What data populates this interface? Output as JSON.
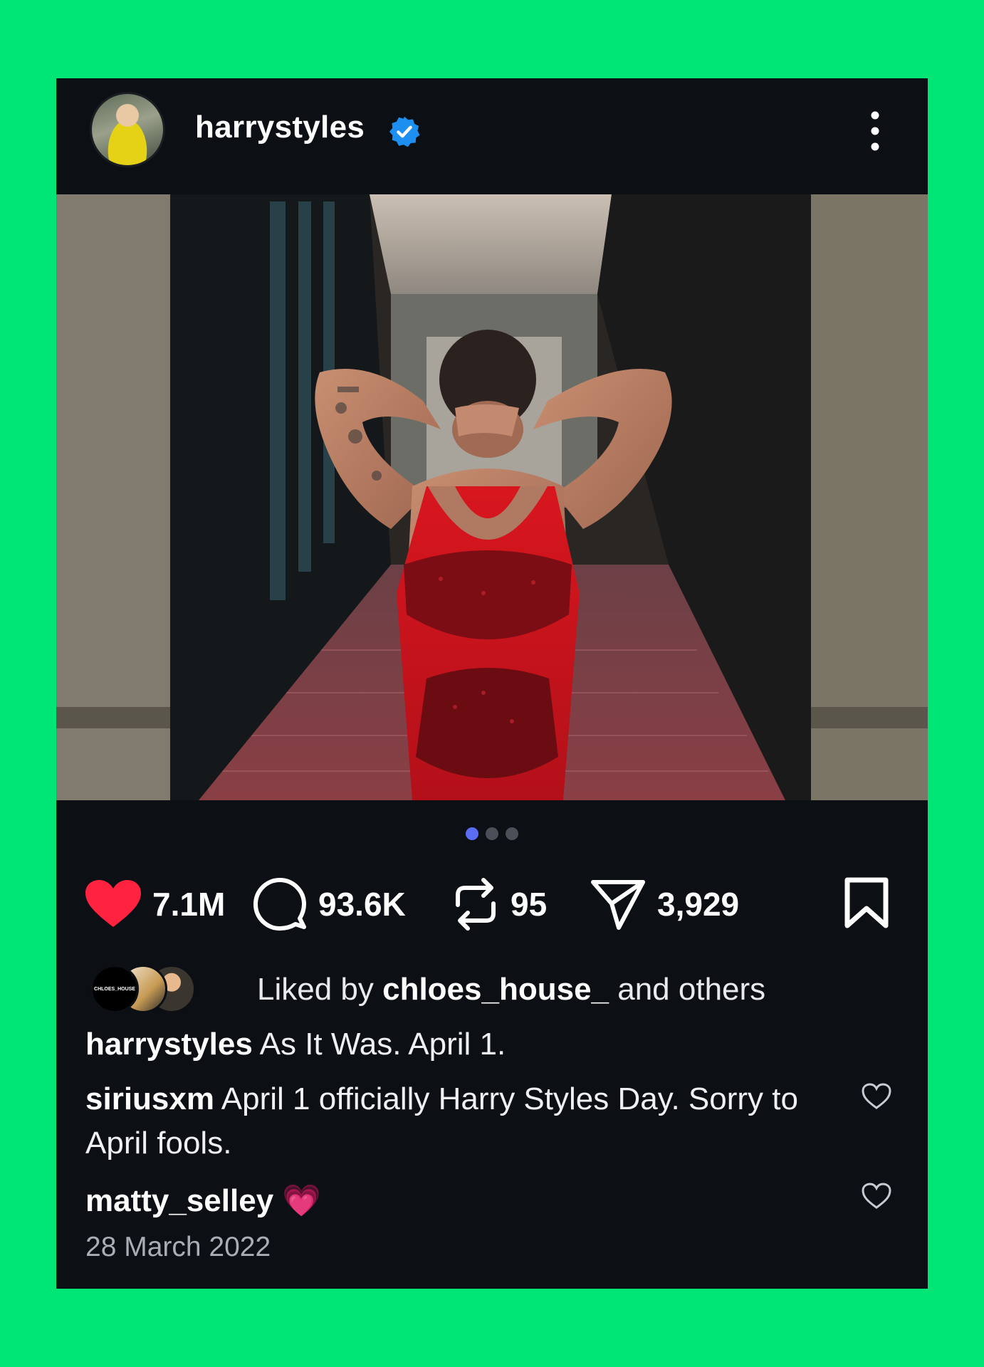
{
  "post": {
    "username": "harrystyles",
    "verified": true,
    "carousel": {
      "total": 3,
      "active": 1
    },
    "stats": {
      "likes": "7.1M",
      "comments": "93.6K",
      "reposts": "95",
      "shares": "3,929"
    },
    "liked_by": {
      "prefix": "Liked by ",
      "user": "chloes_house_",
      "suffix": " and others",
      "avatar_badge": "CHLOES_HOUSE"
    },
    "caption": {
      "user": "harrystyles",
      "text": " As It Was. April 1."
    },
    "comments": [
      {
        "user": "siriusxm",
        "text": " April 1 officially Harry Styles Day. Sorry to April fools."
      },
      {
        "user": "matty_selley",
        "text": " 💗"
      }
    ],
    "date": "28 March 2022"
  },
  "colors": {
    "background": "#00e676",
    "card": "#0c0f14",
    "like_red": "#ff2340",
    "verified_blue": "#1d8ff0",
    "dot_active": "#5b6cf5"
  },
  "icons": [
    "verified-badge-icon",
    "more-vertical-icon",
    "heart-icon",
    "comment-icon",
    "repost-icon",
    "share-icon",
    "bookmark-icon",
    "comment-heart-icon"
  ]
}
